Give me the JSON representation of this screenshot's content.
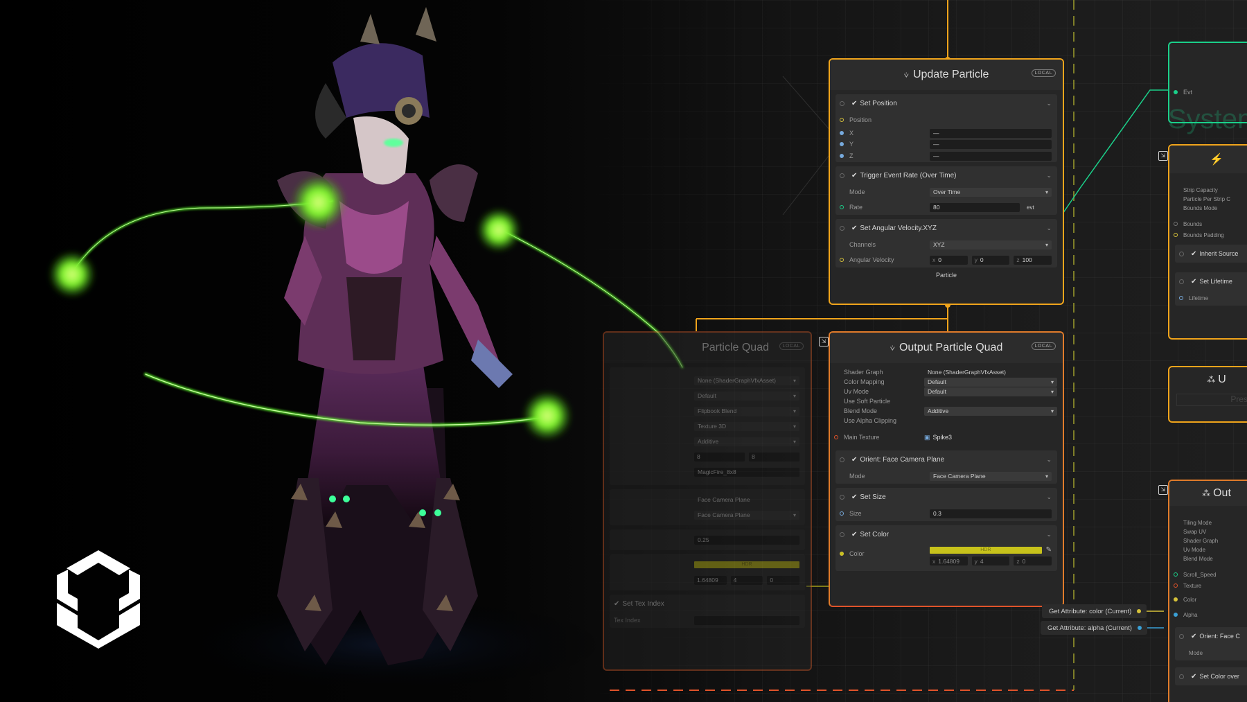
{
  "colors": {
    "accent_orange": "#f0a41b",
    "accent_red": "#e0532a",
    "accent_green": "#1bd08a",
    "color_swatch": "#c7c21b",
    "glow_green": "#5dff2a"
  },
  "update_particle": {
    "title": "Update Particle",
    "tag": "LOCAL",
    "blocks": [
      {
        "title": "Set Position",
        "rows": [
          {
            "label": "Position",
            "value": ""
          },
          {
            "label": "X",
            "value": "—"
          },
          {
            "label": "Y",
            "value": "—"
          },
          {
            "label": "Z",
            "value": "—"
          }
        ]
      },
      {
        "title": "Trigger Event Rate (Over Time)",
        "rows": [
          {
            "label": "Mode",
            "value": "Over Time"
          },
          {
            "label": "Rate",
            "value": "80",
            "out": "evt"
          }
        ]
      },
      {
        "title": "Set Angular Velocity.XYZ",
        "rows": [
          {
            "label": "Channels",
            "value": "XYZ"
          },
          {
            "label": "Angular Velocity",
            "x": "0",
            "y": "0",
            "z": "100"
          }
        ]
      }
    ],
    "output_label": "Particle"
  },
  "output_quad": {
    "title": "Output Particle Quad",
    "tag": "LOCAL",
    "settings": [
      {
        "label": "Shader Graph",
        "value": "None (ShaderGraphVfxAsset)"
      },
      {
        "label": "Color Mapping",
        "value": "Default"
      },
      {
        "label": "Uv Mode",
        "value": "Default"
      },
      {
        "label": "Use Soft Particle",
        "value": ""
      },
      {
        "label": "Blend Mode",
        "value": "Additive"
      },
      {
        "label": "Use Alpha Clipping",
        "value": ""
      }
    ],
    "main_texture": {
      "label": "Main Texture",
      "value": "Spike3"
    },
    "orient": {
      "title": "Orient: Face Camera Plane",
      "mode_label": "Mode",
      "mode_value": "Face Camera Plane"
    },
    "set_size": {
      "title": "Set Size",
      "label": "Size",
      "value": "0.3"
    },
    "set_color": {
      "title": "Set Color",
      "label": "Color",
      "swatch": "HDR",
      "x": "1.64809",
      "y": "4",
      "z": "0"
    }
  },
  "ghost_quad": {
    "title": "Particle Quad",
    "tag": "LOCAL",
    "values": [
      "None (ShaderGraphVfxAsset)",
      "Default",
      "Flipbook Blend",
      "Texture 3D",
      "Additive",
      "8",
      "8",
      "MagicFire_8x8",
      "Face Camera Plane",
      "Face Camera Plane",
      "0.25",
      "HDR",
      "1.64809",
      "4",
      "0",
      "Set Tex Index",
      "Tex Index"
    ]
  },
  "attrs": [
    {
      "label": "Get Attribute: color (Current)"
    },
    {
      "label": "Get Attribute: alpha (Current)"
    }
  ],
  "right_panel": {
    "evt": "Evt",
    "system_text": "System",
    "init_rows": [
      "Strip Capacity",
      "Particle Per Strip C",
      "Bounds Mode"
    ],
    "bounds": [
      "Bounds",
      "Bounds Padding"
    ],
    "inherit": "Inherit Source",
    "set_lifetime": "Set Lifetime",
    "lifetime": "Lifetime",
    "u_title": "U",
    "press": "Press",
    "out_title": "Out",
    "out_rows": [
      "Tiling Mode",
      "Swap UV",
      "Shader Graph",
      "Uv Mode",
      "Blend Mode"
    ],
    "out_ports": [
      "Scroll_Speed",
      "Texture",
      "Color",
      "Alpha"
    ],
    "orient_face": "Orient: Face C",
    "mode": "Mode",
    "set_color_over": "Set Color over"
  }
}
